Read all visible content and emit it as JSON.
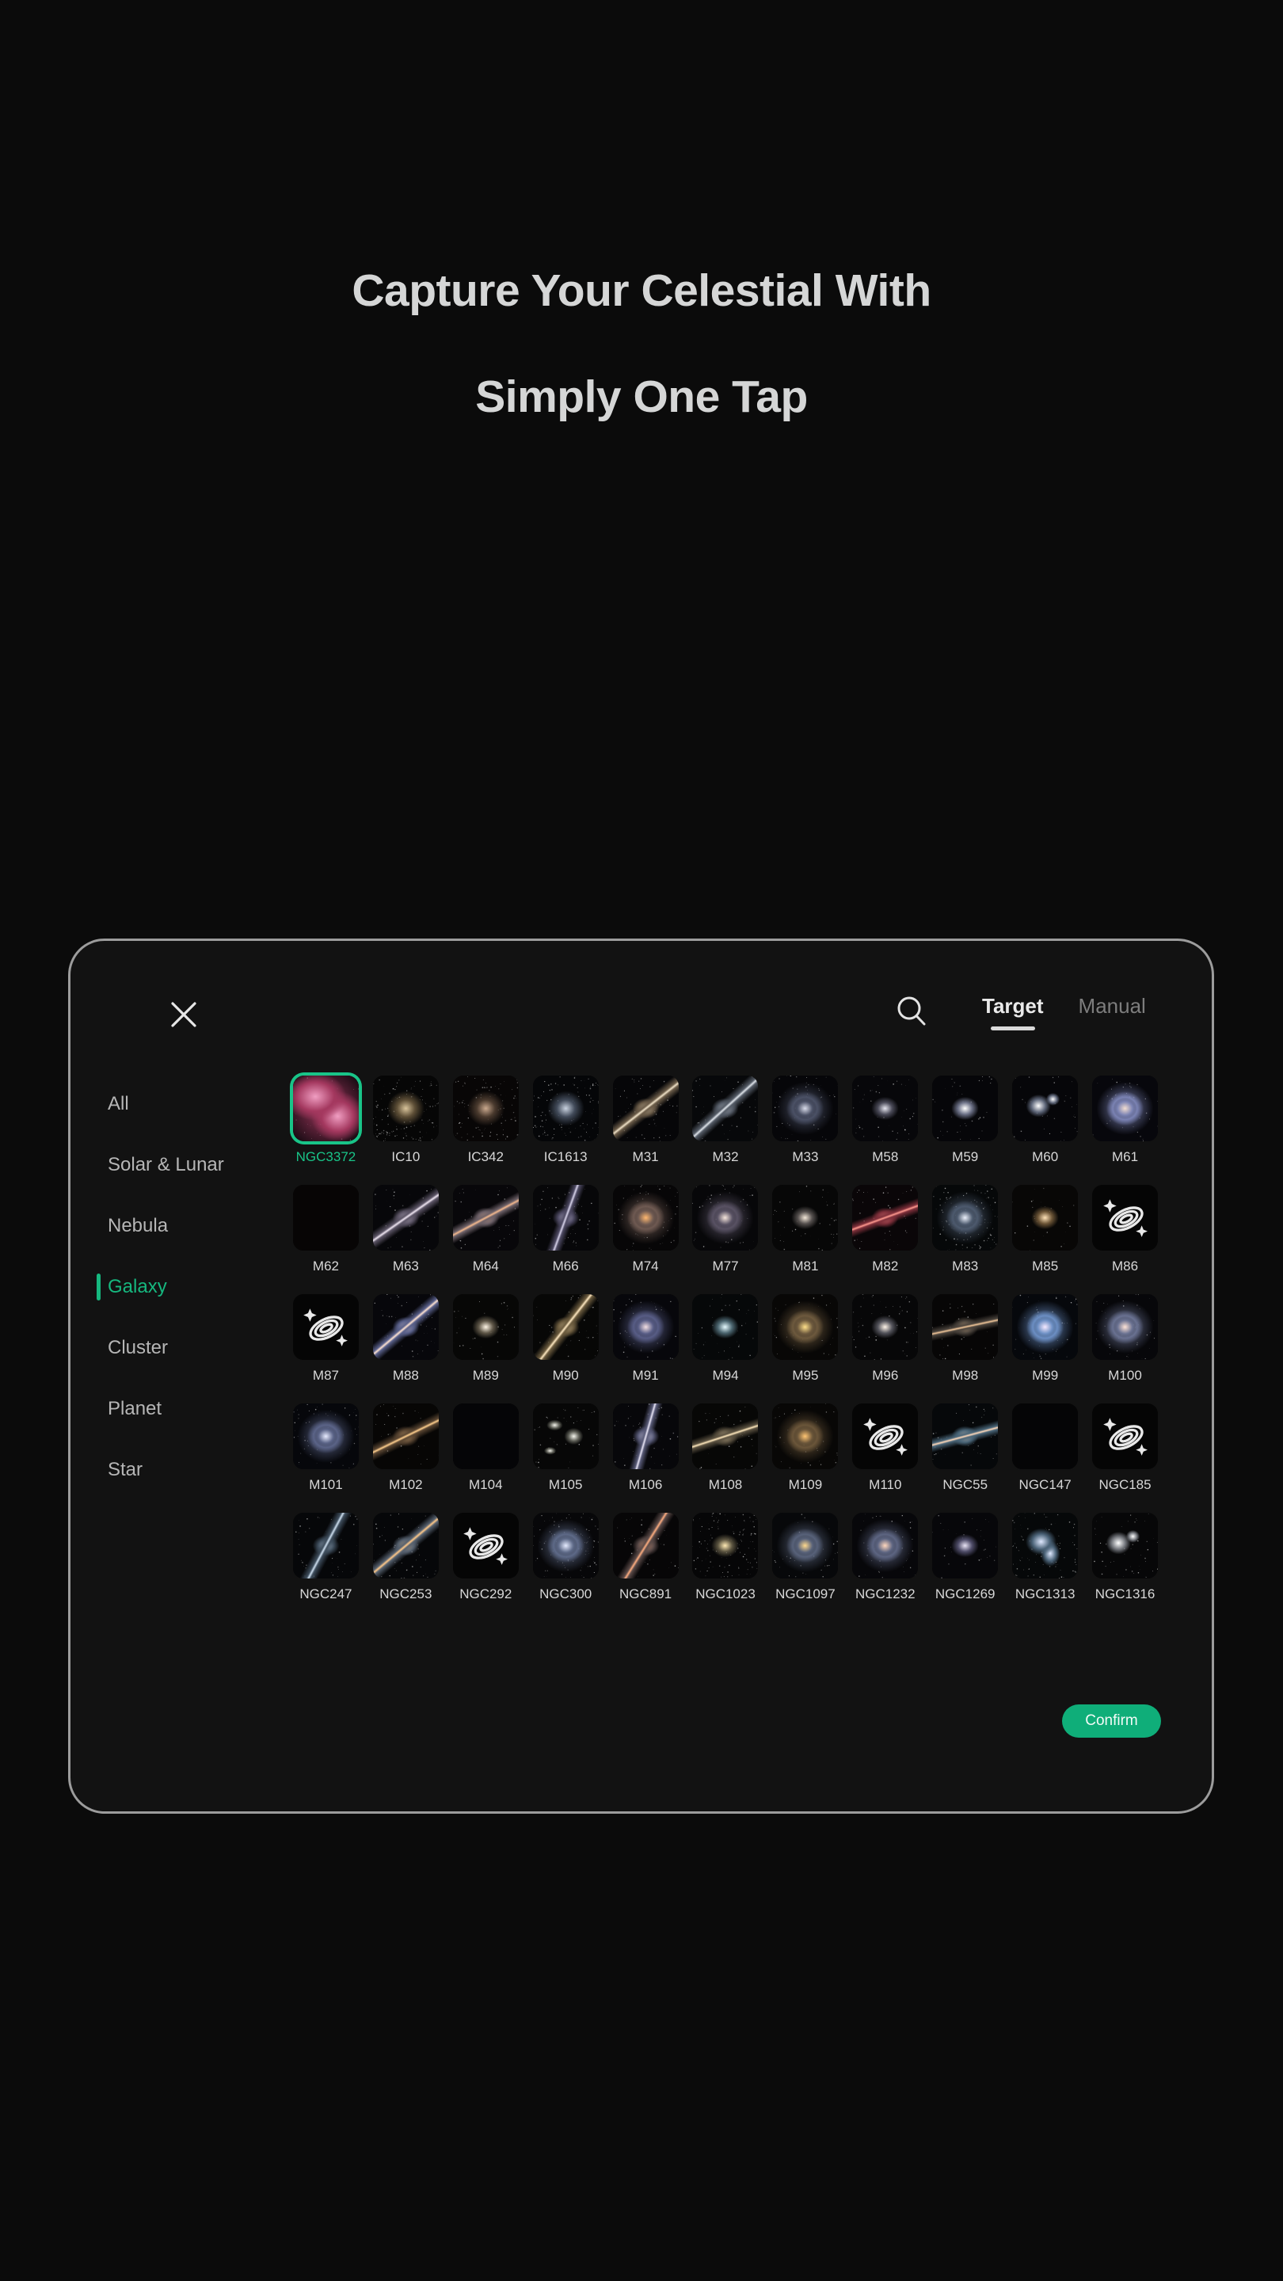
{
  "hero": {
    "line1": "Capture Your Celestial With",
    "line2": "Simply One Tap"
  },
  "dialog": {
    "close_label": "×",
    "search_icon": "search-icon",
    "tabs": [
      {
        "label": "Target",
        "active": true
      },
      {
        "label": "Manual",
        "active": false
      }
    ],
    "confirm_label": "Confirm",
    "accent_color": "#0fae79",
    "selected_color": "#19c488",
    "border_color": "#9c9c9c",
    "surface_color": "#121212",
    "page_background": "#0b0b0b"
  },
  "sidebar": {
    "items": [
      {
        "label": "All",
        "active": false
      },
      {
        "label": "Solar & Lunar",
        "active": false
      },
      {
        "label": "Nebula",
        "active": false
      },
      {
        "label": "Galaxy",
        "active": true
      },
      {
        "label": "Cluster",
        "active": false
      },
      {
        "label": "Planet",
        "active": false
      },
      {
        "label": "Star",
        "active": false
      }
    ]
  },
  "grid": {
    "selected": "NGC3372",
    "items": [
      {
        "label": "NGC3372",
        "kind": "image",
        "art": "nebula-pink",
        "selected": true
      },
      {
        "label": "IC10",
        "kind": "image",
        "art": "starfield-warm"
      },
      {
        "label": "IC342",
        "kind": "image",
        "art": "spiral-dusty"
      },
      {
        "label": "IC1613",
        "kind": "image",
        "art": "starfield-sparse"
      },
      {
        "label": "M31",
        "kind": "image",
        "art": "edge-spiral-warm"
      },
      {
        "label": "M32",
        "kind": "image",
        "art": "edge-spiral-grey"
      },
      {
        "label": "M33",
        "kind": "image",
        "art": "face-spiral-blue"
      },
      {
        "label": "M58",
        "kind": "image",
        "art": "elliptical-soft"
      },
      {
        "label": "M59",
        "kind": "image",
        "art": "elliptical-bright"
      },
      {
        "label": "M60",
        "kind": "image",
        "art": "double-elliptical"
      },
      {
        "label": "M61",
        "kind": "image",
        "art": "spiral-lavender"
      },
      {
        "label": "M62",
        "kind": "image",
        "art": "globular-cluster"
      },
      {
        "label": "M63",
        "kind": "image",
        "art": "spiral-tilted"
      },
      {
        "label": "M64",
        "kind": "image",
        "art": "blackeye-spiral"
      },
      {
        "label": "M66",
        "kind": "image",
        "art": "spiral-pair"
      },
      {
        "label": "M74",
        "kind": "image",
        "art": "grand-spiral-orange"
      },
      {
        "label": "M77",
        "kind": "image",
        "art": "seyfert-core"
      },
      {
        "label": "M81",
        "kind": "image",
        "art": "spiral-smooth"
      },
      {
        "label": "M82",
        "kind": "image",
        "art": "starburst-red"
      },
      {
        "label": "M83",
        "kind": "image",
        "art": "barred-spiral-blue"
      },
      {
        "label": "M85",
        "kind": "image",
        "art": "elliptical-tan"
      },
      {
        "label": "M86",
        "kind": "placeholder",
        "art": "galaxy-glyph"
      },
      {
        "label": "M87",
        "kind": "placeholder",
        "art": "galaxy-glyph"
      },
      {
        "label": "M88",
        "kind": "image",
        "art": "spiral-tilted-blue"
      },
      {
        "label": "M89",
        "kind": "image",
        "art": "elliptical-plain"
      },
      {
        "label": "M90",
        "kind": "image",
        "art": "spiral-gold-tilt"
      },
      {
        "label": "M91",
        "kind": "image",
        "art": "barred-lavender"
      },
      {
        "label": "M94",
        "kind": "image",
        "art": "core-glow-teal"
      },
      {
        "label": "M95",
        "kind": "image",
        "art": "barred-gold"
      },
      {
        "label": "M96",
        "kind": "image",
        "art": "spiral-grey-core"
      },
      {
        "label": "M98",
        "kind": "image",
        "art": "edge-on-thin"
      },
      {
        "label": "M99",
        "kind": "image",
        "art": "spiral-bright-blue"
      },
      {
        "label": "M100",
        "kind": "image",
        "art": "spiral-pinwheel"
      },
      {
        "label": "M101",
        "kind": "image",
        "art": "pinwheel-large"
      },
      {
        "label": "M102",
        "kind": "image",
        "art": "lenticular-gold"
      },
      {
        "label": "M104",
        "kind": "image",
        "art": "dense-starfield"
      },
      {
        "label": "M105",
        "kind": "image",
        "art": "triple-galaxy"
      },
      {
        "label": "M106",
        "kind": "image",
        "art": "spiral-elongated"
      },
      {
        "label": "M108",
        "kind": "image",
        "art": "edge-mottled"
      },
      {
        "label": "M109",
        "kind": "image",
        "art": "barred-amber"
      },
      {
        "label": "M110",
        "kind": "placeholder",
        "art": "galaxy-glyph"
      },
      {
        "label": "NGC55",
        "kind": "image",
        "art": "edge-on-blue"
      },
      {
        "label": "NGC147",
        "kind": "image",
        "art": "dwarf-resolved"
      },
      {
        "label": "NGC185",
        "kind": "placeholder",
        "art": "galaxy-glyph"
      },
      {
        "label": "NGC247",
        "kind": "image",
        "art": "edge-faint-blue"
      },
      {
        "label": "NGC253",
        "kind": "image",
        "art": "sculptor-edge"
      },
      {
        "label": "NGC292",
        "kind": "placeholder",
        "art": "galaxy-glyph"
      },
      {
        "label": "NGC300",
        "kind": "image",
        "art": "face-spiral-white"
      },
      {
        "label": "NGC891",
        "kind": "image",
        "art": "knife-edge"
      },
      {
        "label": "NGC1023",
        "kind": "image",
        "art": "lenticular-field"
      },
      {
        "label": "NGC1097",
        "kind": "image",
        "art": "barred-gold-ring"
      },
      {
        "label": "NGC1232",
        "kind": "image",
        "art": "grand-design"
      },
      {
        "label": "NGC1269",
        "kind": "image",
        "art": "diffuse-halo"
      },
      {
        "label": "NGC1313",
        "kind": "image",
        "art": "irregular-blue"
      },
      {
        "label": "NGC1316",
        "kind": "image",
        "art": "fornax-a"
      }
    ]
  }
}
